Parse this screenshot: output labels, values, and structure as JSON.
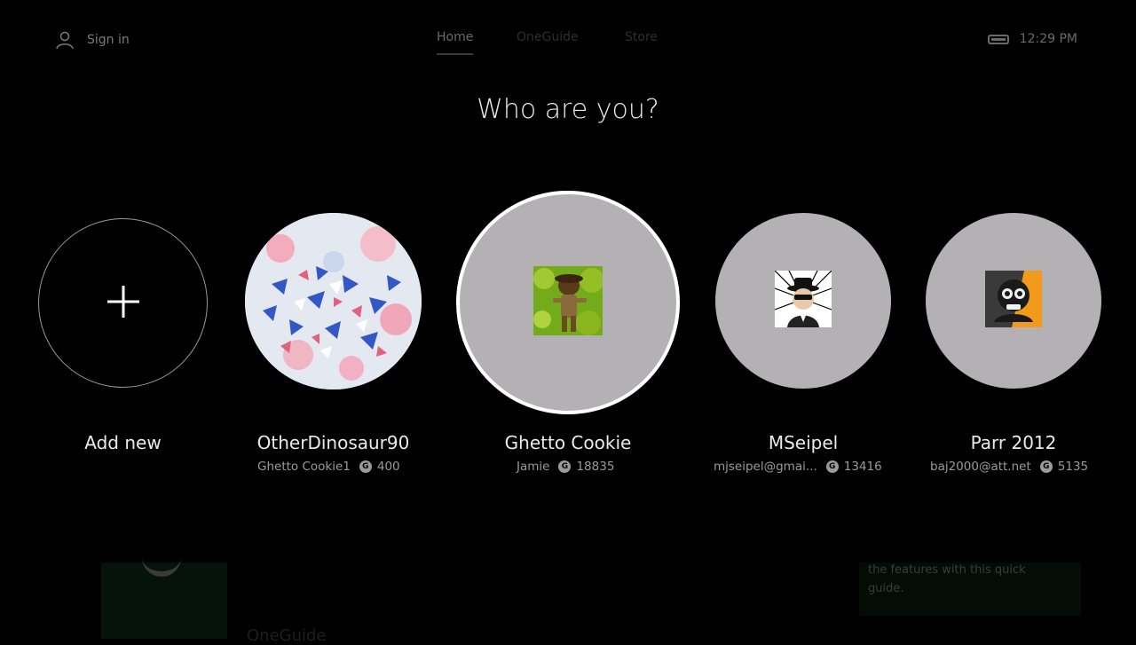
{
  "topbar": {
    "signin_label": "Sign in",
    "tabs": [
      "Home",
      "OneGuide",
      "Store"
    ],
    "time": "12:29 PM"
  },
  "title": "Who are you?",
  "add_new": {
    "label": "Add new"
  },
  "profiles": [
    {
      "name": "OtherDinosaur90",
      "account": "Ghetto Cookie1",
      "gamerscore": "400"
    },
    {
      "name": "Ghetto Cookie",
      "account": "Jamie",
      "gamerscore": "18835",
      "selected": true
    },
    {
      "name": "MSeipel",
      "account": "mjseipel@gmai...",
      "gamerscore": "13416"
    },
    {
      "name": "Parr 2012",
      "account": "baj2000@att.net",
      "gamerscore": "5135"
    }
  ],
  "background": {
    "guide_text": "the features with this quick guide.",
    "bottom_text": "OneGuide"
  },
  "icons": [
    "person-icon",
    "battery-icon",
    "plus-icon",
    "gamerscore-icon"
  ]
}
